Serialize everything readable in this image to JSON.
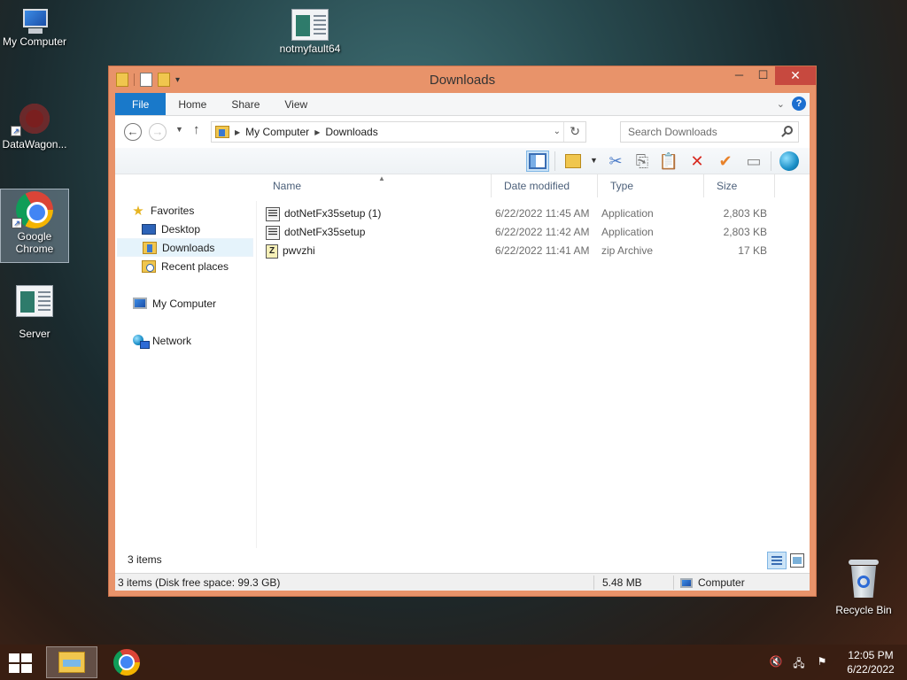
{
  "desktop": {
    "icons": [
      {
        "label": "My Computer"
      },
      {
        "label": "notmyfault64"
      },
      {
        "label": "DataWagon..."
      },
      {
        "label": "Google Chrome"
      },
      {
        "label": "Server"
      },
      {
        "label": "Recycle Bin"
      }
    ]
  },
  "window": {
    "title": "Downloads",
    "minimize": "─",
    "maximize": "☐",
    "close": "✕"
  },
  "ribbon": {
    "tabs": [
      "File",
      "Home",
      "Share",
      "View"
    ],
    "help": "?"
  },
  "address": {
    "crumbs": [
      "My Computer",
      "Downloads"
    ]
  },
  "search": {
    "placeholder": "Search Downloads"
  },
  "nav": {
    "favorites": "Favorites",
    "desktop": "Desktop",
    "downloads": "Downloads",
    "recent": "Recent places",
    "computer": "My Computer",
    "network": "Network"
  },
  "columns": {
    "name": "Name",
    "date": "Date modified",
    "type": "Type",
    "size": "Size"
  },
  "files": [
    {
      "name": "dotNetFx35setup (1)",
      "date": "6/22/2022 11:45 AM",
      "type": "Application",
      "size": "2,803 KB",
      "icon": "application-icon"
    },
    {
      "name": "dotNetFx35setup",
      "date": "6/22/2022 11:42 AM",
      "type": "Application",
      "size": "2,803 KB",
      "icon": "application-icon"
    },
    {
      "name": "pwvzhi",
      "date": "6/22/2022 11:41 AM",
      "type": "zip Archive",
      "size": "17 KB",
      "icon": "zip-icon"
    }
  ],
  "item_count": "3 items",
  "statusbar": {
    "summary": "3 items (Disk free space: 99.3 GB)",
    "size": "5.48 MB",
    "location": "Computer"
  },
  "clock": {
    "time": "12:05 PM",
    "date": "6/22/2022"
  },
  "colors": {
    "window_frame": "#e8936a",
    "file_tab": "#1979ca",
    "close_button": "#c7493f"
  }
}
